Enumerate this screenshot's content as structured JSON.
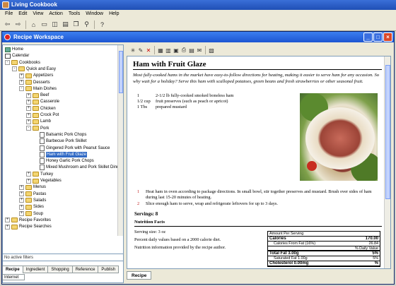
{
  "app": {
    "title": "Living Cookbook"
  },
  "menu": [
    "File",
    "Edit",
    "View",
    "Action",
    "Tools",
    "Window",
    "Help"
  ],
  "workspace": {
    "title": "Recipe Workspace"
  },
  "tree": [
    {
      "label": "Home",
      "level": 0,
      "icon": "home",
      "expander": ""
    },
    {
      "label": "Calendar",
      "level": 0,
      "icon": "calendar",
      "expander": ""
    },
    {
      "label": "Cookbooks",
      "level": 0,
      "icon": "folder",
      "expander": "-"
    },
    {
      "label": "Quick and Easy",
      "level": 1,
      "icon": "folder",
      "expander": "-"
    },
    {
      "label": "Appetizers",
      "level": 2,
      "icon": "folder",
      "expander": "+"
    },
    {
      "label": "Desserts",
      "level": 2,
      "icon": "folder",
      "expander": "+"
    },
    {
      "label": "Main Dishes",
      "level": 2,
      "icon": "folder",
      "expander": "-"
    },
    {
      "label": "Beef",
      "level": 3,
      "icon": "folder",
      "expander": "+"
    },
    {
      "label": "Casserole",
      "level": 3,
      "icon": "folder",
      "expander": "+"
    },
    {
      "label": "Chicken",
      "level": 3,
      "icon": "folder",
      "expander": "+"
    },
    {
      "label": "Crock Pot",
      "level": 3,
      "icon": "folder",
      "expander": "+"
    },
    {
      "label": "Lamb",
      "level": 3,
      "icon": "folder",
      "expander": "+"
    },
    {
      "label": "Pork",
      "level": 3,
      "icon": "folder",
      "expander": "-"
    },
    {
      "label": "Balsamic Pork Chops",
      "level": 4,
      "icon": "doc",
      "expander": ""
    },
    {
      "label": "Barbecue Pork Skillet",
      "level": 4,
      "icon": "doc",
      "expander": ""
    },
    {
      "label": "Gingered Pork with Peanut Sauce",
      "level": 4,
      "icon": "doc",
      "expander": ""
    },
    {
      "label": "Ham with Fruit Glaze",
      "level": 4,
      "icon": "doc",
      "expander": "",
      "selected": true
    },
    {
      "label": "Honey Garlic Pork Chops",
      "level": 4,
      "icon": "doc",
      "expander": ""
    },
    {
      "label": "Mixed Mushroom and Pork Skillet Dinner",
      "level": 4,
      "icon": "doc",
      "expander": ""
    },
    {
      "label": "Turkey",
      "level": 3,
      "icon": "folder",
      "expander": "+"
    },
    {
      "label": "Vegetables",
      "level": 3,
      "icon": "folder",
      "expander": "+"
    },
    {
      "label": "Menus",
      "level": 2,
      "icon": "folder",
      "expander": "+"
    },
    {
      "label": "Pastas",
      "level": 2,
      "icon": "folder",
      "expander": "+"
    },
    {
      "label": "Salads",
      "level": 2,
      "icon": "folder",
      "expander": "+"
    },
    {
      "label": "Sides",
      "level": 2,
      "icon": "folder",
      "expander": "+"
    },
    {
      "label": "Soup",
      "level": 2,
      "icon": "folder",
      "expander": "+"
    },
    {
      "label": "Recipe Favorites",
      "level": 0,
      "icon": "folder",
      "expander": "+"
    },
    {
      "label": "Recipe Searches",
      "level": 0,
      "icon": "folder",
      "expander": "+"
    }
  ],
  "filter_text": "No active filters",
  "left_tabs": [
    "Recipe",
    "Ingredient",
    "Shopping",
    "Reference",
    "Publish"
  ],
  "left_active_tab": "Recipe",
  "internet_label": "Internet",
  "recipe": {
    "title": "Ham with Fruit Glaze",
    "intro": "Most fully-cooked hams in the market have easy-to-follow directions for heating, making it easier to serve ham for any occasion. So why wait for a holiday? Serve this ham with scalloped potatoes, green beans and fresh strawberries or other seasonal fruit.",
    "ingredients": [
      {
        "qty": "1",
        "unit": "",
        "item": "2-1/2 lb fully-cooked smoked boneless ham"
      },
      {
        "qty": "1/2 cup",
        "unit": "",
        "item": "fruit preserves (such as peach or apricot)"
      },
      {
        "qty": "1 Tbs",
        "unit": "",
        "item": "prepared mustard"
      }
    ],
    "steps": [
      {
        "num": "1",
        "text": "Heat ham in oven according to package directions. In small bowl, stir together preserves and mustard. Brush over sides of ham during last 15-20 minutes of heating."
      },
      {
        "num": "2",
        "text": "Slice enough ham to serve, wrap and refrigerate leftovers for up to 3 days."
      }
    ],
    "servings": "Servings: 8",
    "nutrition_heading": "Nutrition Facts",
    "serving_size": "Serving size: 3 oz",
    "daily_note": "Percent daily values based on a 2000 calorie diet.",
    "provided_note": "Nutrition information provided by the recipe author.",
    "nutrition_table": {
      "header": "Amount Per Serving",
      "calories_label": "Calories",
      "calories_value": "170.00",
      "calories_fat_label": "Calories From Fat (16%)",
      "calories_fat_value": "26.84",
      "dv_label": "% Daily Value",
      "total_fat_label": "Total Fat 3.00g",
      "total_fat_value": "5%",
      "sat_fat_label": "Saturated Fat 1.00g",
      "sat_fat_value": "5%",
      "chol_label": "Cholesterol 0.00mg",
      "chol_value": "%"
    }
  },
  "right_tabs": [
    "Recipe"
  ]
}
